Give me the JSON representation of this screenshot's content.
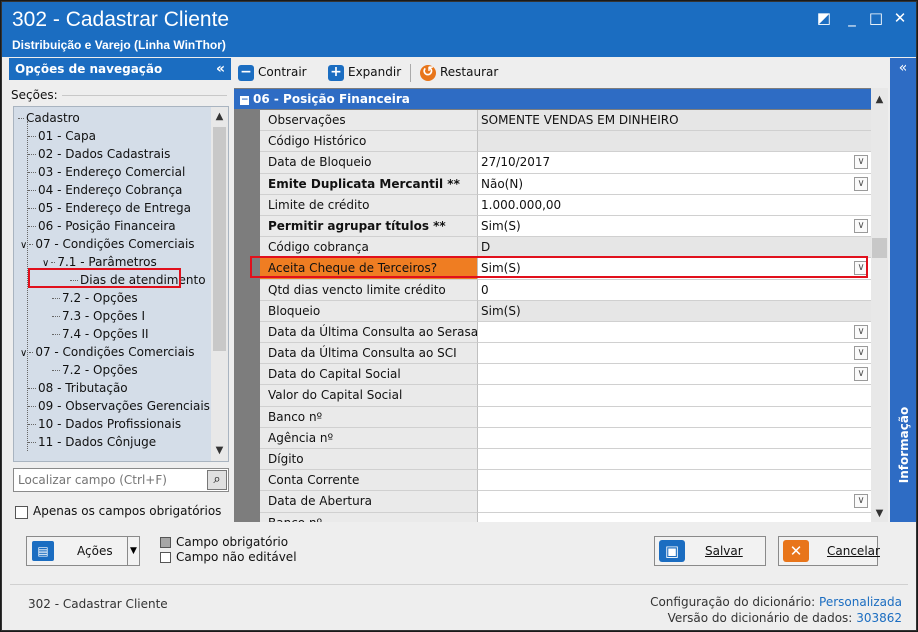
{
  "window": {
    "title": "302 - Cadastrar Cliente",
    "subtitle": "Distribuição e Varejo (Linha WinThor)",
    "controls": {
      "restore": "◩",
      "minimize": "_",
      "maximize": "□",
      "close": "✕"
    }
  },
  "nav": {
    "header": "Opções de navegação",
    "collapse": "«",
    "sections_label": "Seções:",
    "tree": [
      {
        "label": "Cadastro",
        "level": 0
      },
      {
        "label": "01 - Capa",
        "level": 1
      },
      {
        "label": "02 - Dados Cadastrais",
        "level": 1
      },
      {
        "label": "03 - Endereço Comercial",
        "level": 1
      },
      {
        "label": "04 - Endereço Cobrança",
        "level": 1
      },
      {
        "label": "05 - Endereço de Entrega",
        "level": 1
      },
      {
        "label": "06 - Posição Financeira",
        "level": 1
      },
      {
        "label": "07 - Condições Comerciais",
        "level": 1
      },
      {
        "label": "7.1 - Parâmetros",
        "level": 2
      },
      {
        "label": "Dias de atendimento",
        "level": 3
      },
      {
        "label": "7.2 - Opções",
        "level": 2
      },
      {
        "label": "7.3 - Opções I",
        "level": 2
      },
      {
        "label": "7.4 - Opções II",
        "level": 2
      },
      {
        "label": "07 - Condições Comerciais",
        "level": 1
      },
      {
        "label": "7.2 - Opções",
        "level": 2
      },
      {
        "label": "08 - Tributação",
        "level": 1
      },
      {
        "label": "09 - Observações Gerenciais",
        "level": 1
      },
      {
        "label": "10 - Dados Profissionais",
        "level": 1
      },
      {
        "label": "11 - Dados Cônjuge",
        "level": 1
      }
    ],
    "search_placeholder": "Localizar campo (Ctrl+F)",
    "only_required_label": "Apenas os campos obrigatórios"
  },
  "toolbar": {
    "collapse": "Contrair",
    "expand": "Expandir",
    "restore": "Restaurar"
  },
  "grid": {
    "group_title": "06 - Posição Financeira",
    "rows": [
      {
        "label": "Observações",
        "value": "SOMENTE VENDAS EM DINHEIRO",
        "readonly": true
      },
      {
        "label": "Código Histórico",
        "value": "",
        "readonly": true
      },
      {
        "label": "Data de Bloqueio",
        "value": "27/10/2017",
        "dropdown": true
      },
      {
        "label": "Emite Duplicata Mercantil **",
        "value": "Não(N)",
        "dropdown": true,
        "bold": true
      },
      {
        "label": "Limite de crédito",
        "value": "1.000.000,00"
      },
      {
        "label": "Permitir agrupar títulos **",
        "value": "Sim(S)",
        "dropdown": true,
        "bold": true
      },
      {
        "label": "Código cobrança",
        "value": "D",
        "readonly": true
      },
      {
        "label": "Aceita Cheque de Terceiros?",
        "value": "Sim(S)",
        "dropdown": true,
        "highlight": true
      },
      {
        "label": "Qtd dias vencto limite crédito",
        "value": "0"
      },
      {
        "label": "Bloqueio",
        "value": "Sim(S)",
        "readonly": true
      },
      {
        "label": "Data da Última Consulta ao Serasa",
        "value": "",
        "dropdown": true
      },
      {
        "label": "Data da Última Consulta ao SCI",
        "value": "",
        "dropdown": true
      },
      {
        "label": "Data do Capital Social",
        "value": "",
        "dropdown": true
      },
      {
        "label": "Valor do Capital Social",
        "value": ""
      },
      {
        "label": "Banco nº",
        "value": ""
      },
      {
        "label": "Agência nº",
        "value": ""
      },
      {
        "label": "Dígito",
        "value": ""
      },
      {
        "label": "Conta Corrente",
        "value": ""
      },
      {
        "label": "Data de Abertura",
        "value": "",
        "dropdown": true
      },
      {
        "label": "Banco nº",
        "value": ""
      }
    ]
  },
  "info_tab": {
    "label": "Informação",
    "collapse": "«"
  },
  "actions": {
    "acoes_label": "Ações",
    "legend_required": "Campo obrigatório",
    "legend_readonly": "Campo não editável",
    "save_label": "Salvar",
    "cancel_label": "Cancelar"
  },
  "status": {
    "left": "302 - Cadastrar Cliente",
    "dict_config_label": "Configuração do dicionário:",
    "dict_config_value": "Personalizada",
    "dict_version_label": "Versão do dicionário de dados:",
    "dict_version_value": "303862"
  },
  "colors": {
    "accent": "#1b6dc1",
    "highlight_row": "#ef7d22",
    "callout_border": "#e1101c"
  }
}
